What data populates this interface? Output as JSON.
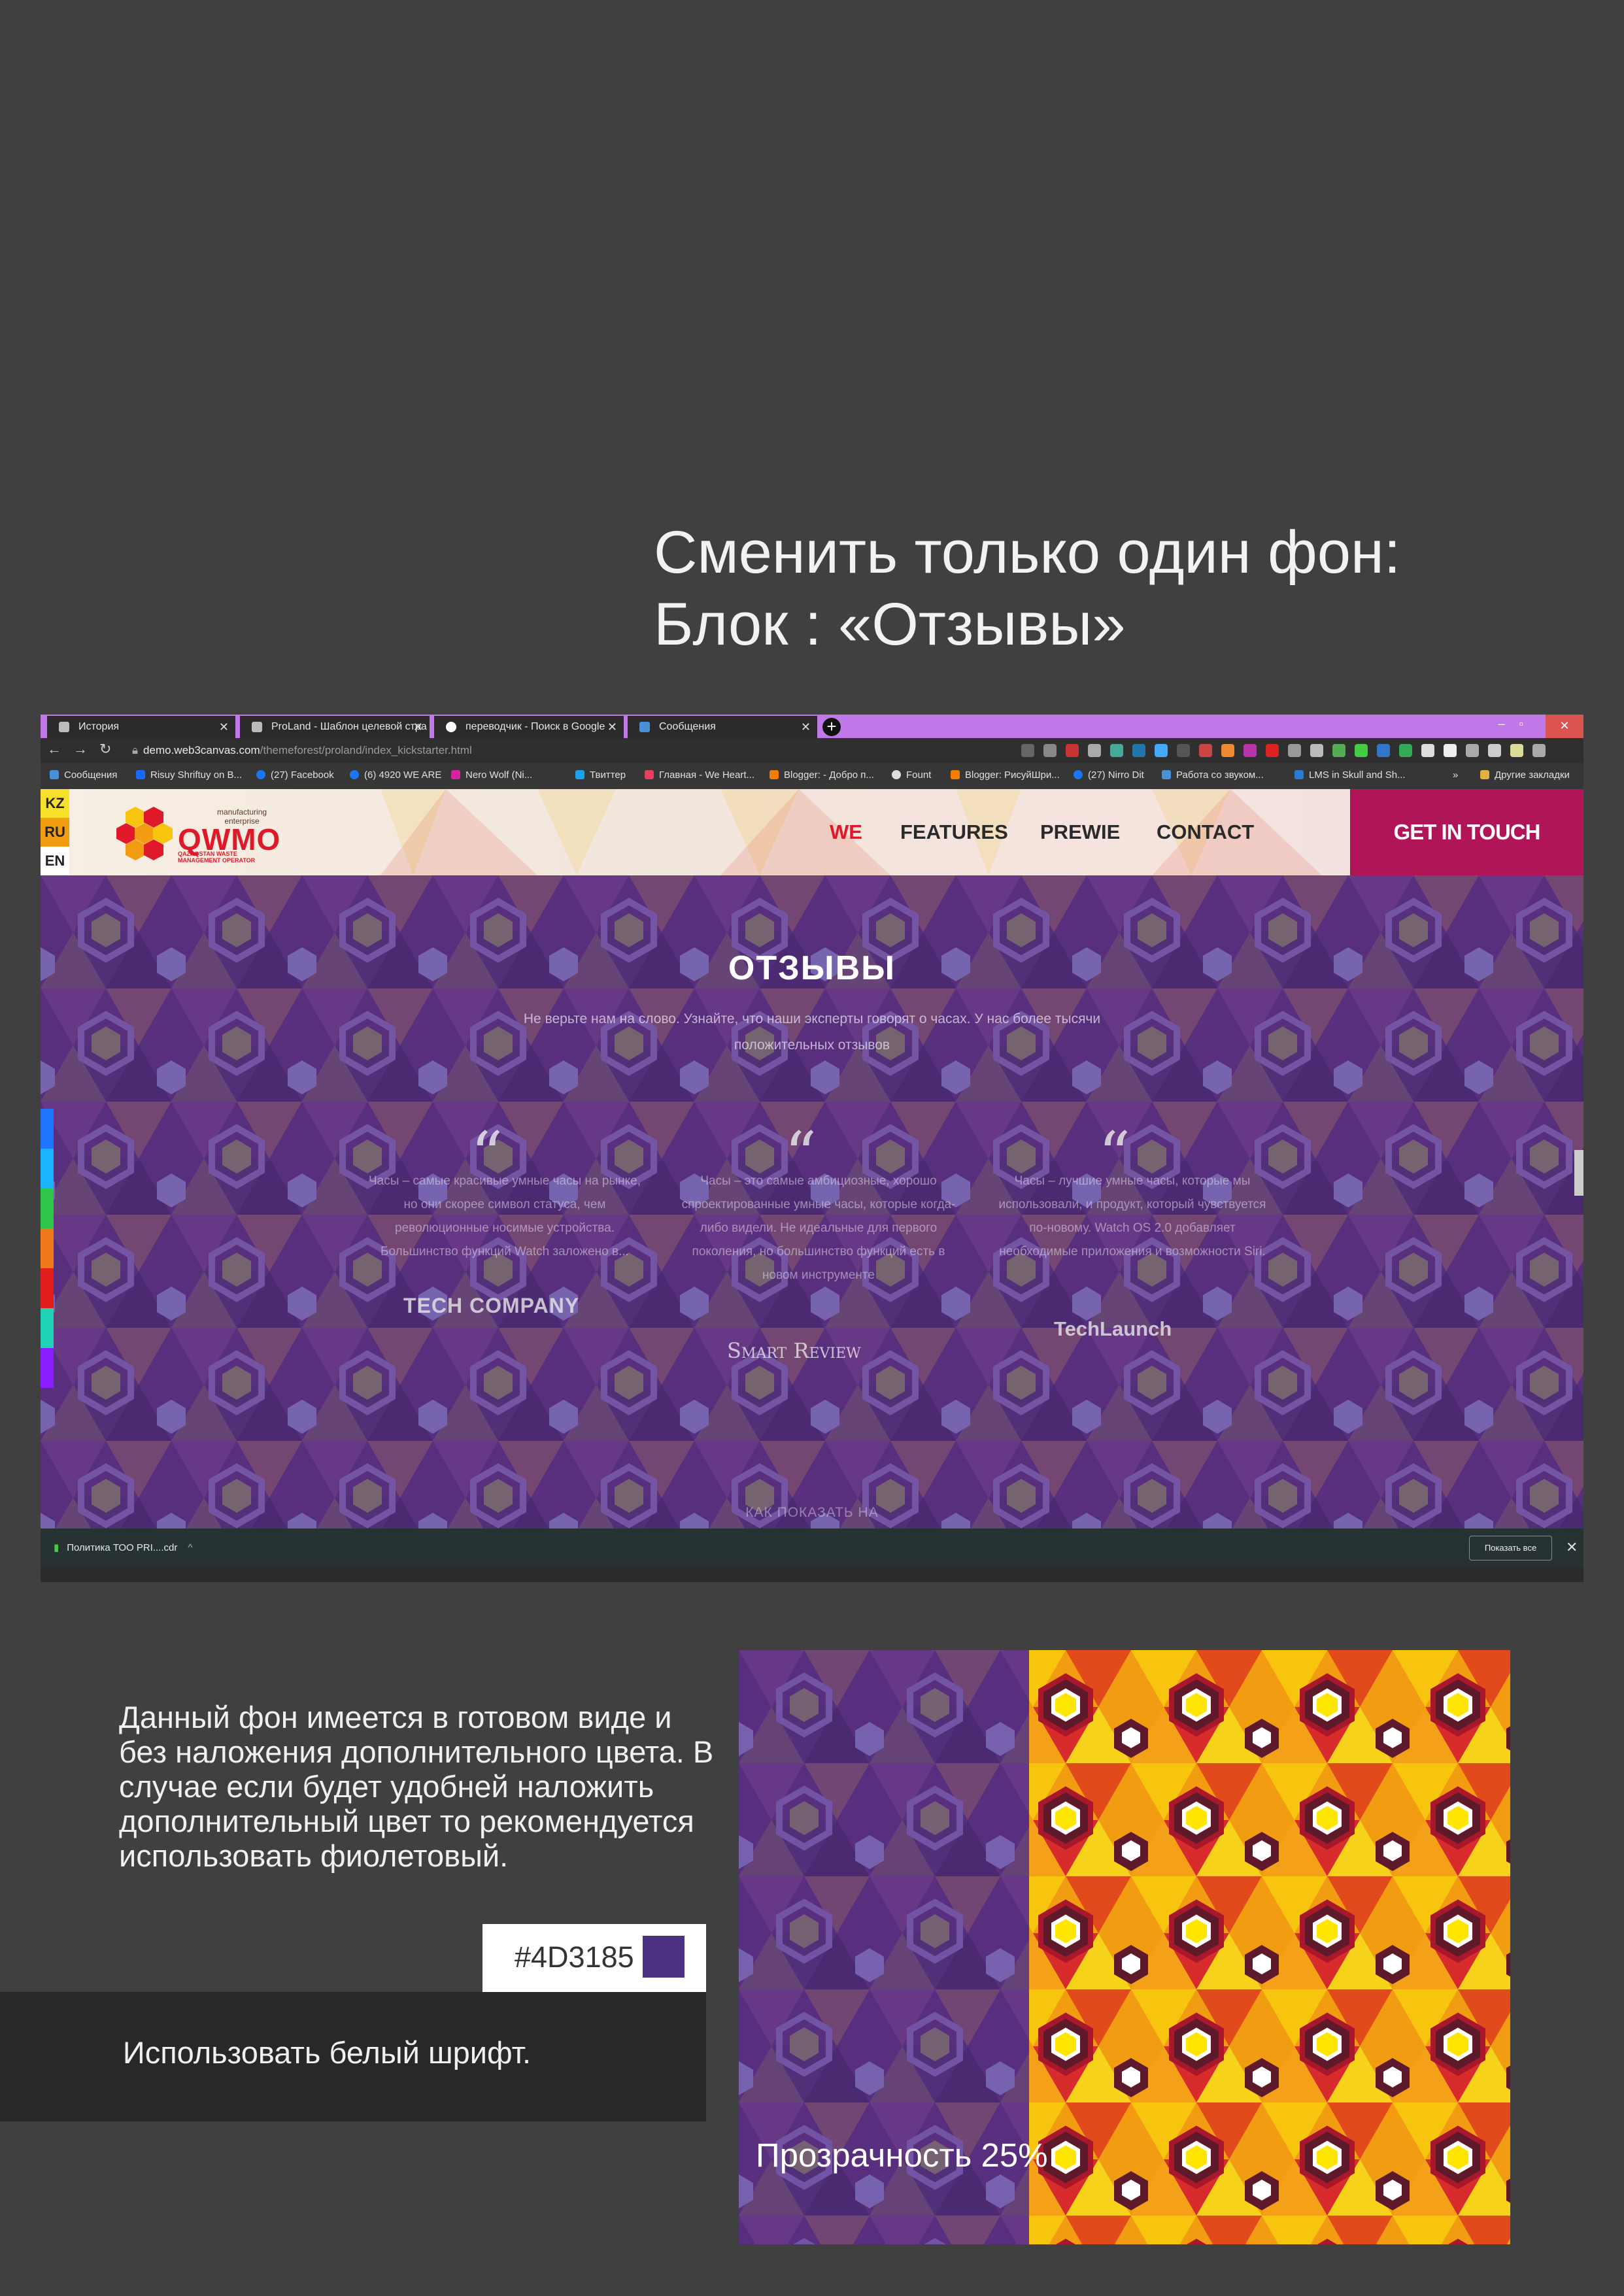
{
  "headline": {
    "line1": "Сменить только один фон:",
    "line2": "Блок : «Отзывы»"
  },
  "browser": {
    "tabs": [
      {
        "label": "История"
      },
      {
        "label": "ProLand - Шаблон целевой стра"
      },
      {
        "label": "переводчик - Поиск в Google"
      },
      {
        "label": "Сообщения"
      }
    ],
    "url_host": "demo.web3canvas.com",
    "url_path": "/themeforest/proland/index_kickstarter.html",
    "bookmarks": [
      "Сообщения",
      "Risuy Shriftuy on B...",
      "(27) Facebook",
      "(6) 4920 WE ARE",
      "Nero Wolf (Ni...",
      "Твиттер",
      "Главная - We Heart...",
      "Blogger: - Добро п...",
      "Fount",
      "Blogger: РисуйШри...",
      "(27) Nirro Dit",
      "Работа со звуком...",
      "LMS in Skull and Sh...",
      "»",
      "Другие закладки"
    ],
    "colors": {
      "tabbar": "#c078e8",
      "cta": "#b01558",
      "testimonial_bg": "#5b2f7d"
    }
  },
  "site": {
    "languages": [
      "KZ",
      "RU",
      "EN"
    ],
    "logo": {
      "brand": "QWMO",
      "tagline": "manufacturing\nenterprise",
      "subtitle": "QAZAQSTAN WASTE\nMANAGEMENT OPERATOR"
    },
    "nav": [
      "WE",
      "FEATURES",
      "PREWIE",
      "CONTACT"
    ],
    "cta": "GET IN TOUCH",
    "testimonials": {
      "title": "ОТЗЫВЫ",
      "subtitle": "Не верьте нам на слово. Узнайте, что наши эксперты говорят о часах. У нас более тысячи положительных отзывов",
      "items": [
        {
          "quote_mark": "“",
          "text": "Часы – самые красивые умные часы на рынке, но они скорее символ статуса, чем революционные носимые устройства. Большинство функций Watch заложено в...",
          "brand": "TECH COMPANY"
        },
        {
          "quote_mark": "“",
          "text": "Часы – это самые амбициозные, хорошо спроектированные умные часы, которые когда-либо видели. Не идеальные для первого поколения, но большинство функций есть в новом инструменте",
          "brand": "Smart Review"
        },
        {
          "quote_mark": "“",
          "text": "Часы – лучшие умные часы, которые мы использовали, и продукт, который чувствуется по-новому. Watch OS 2.0 добавляет необходимые приложения и возможности Siri.",
          "brand": "TechLaunch"
        }
      ],
      "bottom": "КАК ПОКАЗАТЬ НА"
    }
  },
  "download_bar": {
    "file": "Политика ТОО PRI....cdr",
    "show_all": "Показать все",
    "close": "✕"
  },
  "description": "Данный фон имеется в готовом виде и без наложения дополнительного цвета. В случае если будет удобней наложить дополнительный цвет то рекомендуется использовать фиолетовый.",
  "swatch": {
    "hex_label": "#4D3185",
    "color": "#4D3185"
  },
  "white_font_note": "Использовать белый шрифт.",
  "transparency_label": "Прозрачность 25%"
}
